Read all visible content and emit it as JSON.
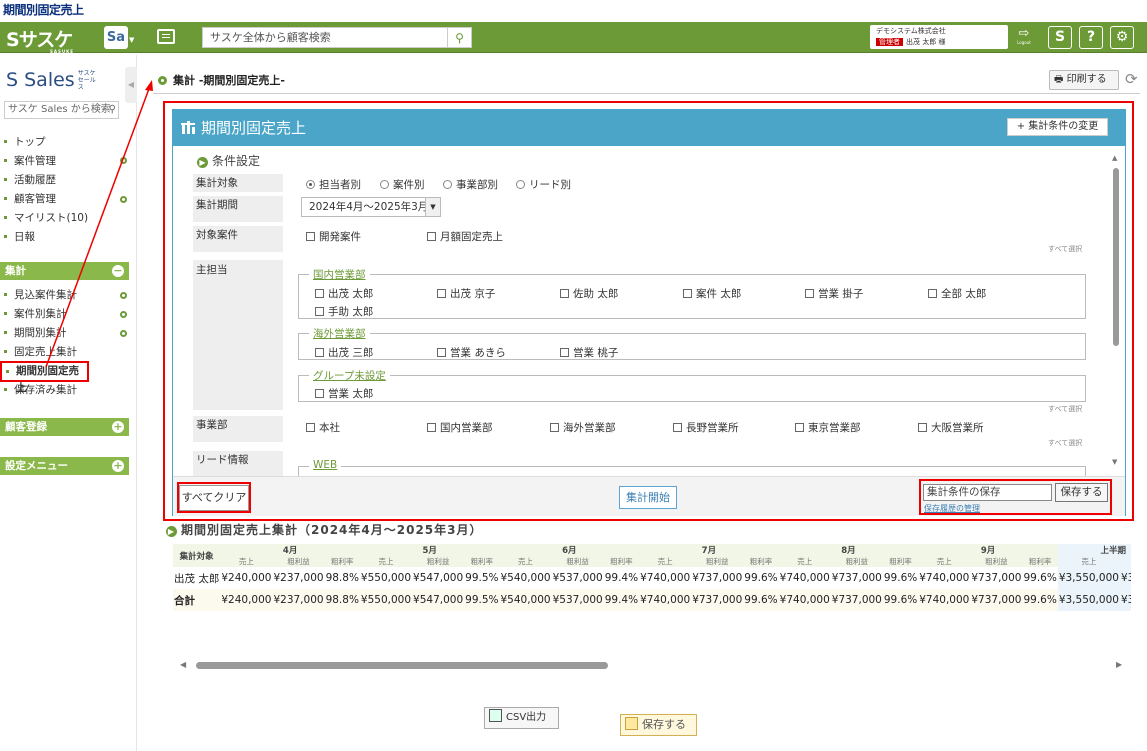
{
  "doc_title": "期間別固定売上",
  "topbar": {
    "logo": "サスケ",
    "logo_sub": "SASUKE",
    "app_switch": "Sa",
    "search_placeholder": "サスケ全体から顧客検索",
    "company": "デモシステム株式会社",
    "user_badge": "管理者",
    "user": "出茂 太郎 様",
    "logout": "Logout",
    "btn_sasuke": "S",
    "btn_help": "?",
    "btn_settings": "⚙"
  },
  "sidebar": {
    "logo": "Sales",
    "logo_sub": "サスケ セールス",
    "search_placeholder": "サスケ Sales から検索",
    "items": [
      "トップ",
      "案件管理",
      "活動履歴",
      "顧客管理",
      "マイリスト(10)",
      "日報"
    ],
    "section_shuukei": "集計",
    "shuukei_items": [
      "見込案件集計",
      "案件別集計",
      "期間別集計",
      "固定売上集計",
      "期間別固定売上",
      "保存済み集計"
    ],
    "section_kokyaku": "顧客登録",
    "section_settings": "設定メニュー"
  },
  "breadcrumb": "集計 -期間別固定売上-",
  "print_label": "印刷する",
  "panel": {
    "title": "期間別固定売上",
    "change_cond": "+ 集計条件の変更",
    "cond_title": "条件設定",
    "label_target": "集計対象",
    "target_options": [
      "担当者別",
      "案件別",
      "事業部別",
      "リード別"
    ],
    "label_period": "集計期間",
    "period_value": "2024年4月～2025年3月",
    "label_deals": "対象案件",
    "deal_options": [
      "開発案件",
      "月額固定売上"
    ],
    "select_all": "すべて選択",
    "label_staff": "主担当",
    "group1": "国内営業部",
    "group1_members": [
      "出茂 太郎",
      "出茂 京子",
      "佐助 太郎",
      "案件 太郎",
      "営業 掛子",
      "全部 太郎",
      "手助 太郎"
    ],
    "group2": "海外営業部",
    "group2_members": [
      "出茂 三郎",
      "営業 あきら",
      "営業 桃子"
    ],
    "group3": "グループ未設定",
    "group3_members": [
      "営業 太郎"
    ],
    "label_division": "事業部",
    "divisions": [
      "本社",
      "国内営業部",
      "海外営業部",
      "長野営業所",
      "東京営業部",
      "大阪営業所"
    ],
    "label_lead": "リード情報",
    "lead_group": "WEB",
    "btn_clear": "すべてクリア",
    "btn_start": "集計開始",
    "save_placeholder": "集計条件の保存",
    "btn_save": "保存する",
    "save_history": "保存履歴の管理"
  },
  "result": {
    "title": "期間別固定売上集計（2024年4月～2025年3月）",
    "col_target": "集計対象",
    "months": [
      "4月",
      "5月",
      "6月",
      "7月",
      "8月",
      "9月"
    ],
    "period_label": "上半期",
    "sub_headers": [
      "売上",
      "粗利益",
      "粗利率"
    ],
    "rows": [
      {
        "name": "出茂 太郎",
        "cells": [
          "¥240,000",
          "¥237,000",
          "98.8%",
          "¥550,000",
          "¥547,000",
          "99.5%",
          "¥540,000",
          "¥537,000",
          "99.4%",
          "¥740,000",
          "¥737,000",
          "99.6%",
          "¥740,000",
          "¥737,000",
          "99.6%",
          "¥740,000",
          "¥737,000",
          "99.6%",
          "¥3,550,000",
          "¥3,532,0"
        ]
      },
      {
        "name": "合計",
        "cells": [
          "¥240,000",
          "¥237,000",
          "98.8%",
          "¥550,000",
          "¥547,000",
          "99.5%",
          "¥540,000",
          "¥537,000",
          "99.4%",
          "¥740,000",
          "¥737,000",
          "99.6%",
          "¥740,000",
          "¥737,000",
          "99.6%",
          "¥740,000",
          "¥737,000",
          "99.6%",
          "¥3,550,000",
          "¥3,532,0"
        ]
      }
    ]
  },
  "footer": {
    "csv": "CSV出力",
    "save": "保存する"
  }
}
